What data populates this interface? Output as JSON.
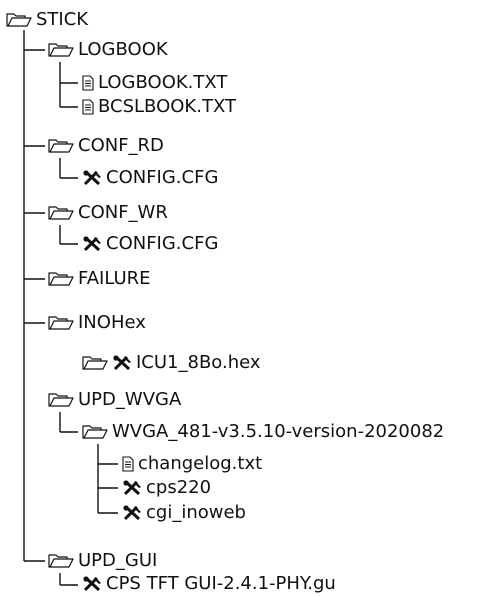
{
  "root": {
    "label": "STICK",
    "icon": "folder-icon"
  },
  "logbook": {
    "label": "LOGBOOK",
    "icon": "folder-icon",
    "files": [
      {
        "label": "LOGBOOK.TXT",
        "icon": "text-file-icon"
      },
      {
        "label": "BCSLBOOK.TXT",
        "icon": "text-file-icon"
      }
    ]
  },
  "conf_rd": {
    "label": "CONF_RD",
    "icon": "folder-icon",
    "file": {
      "label": "CONFIG.CFG",
      "icon": "tools-icon"
    }
  },
  "conf_wr": {
    "label": "CONF_WR",
    "icon": "folder-icon",
    "file": {
      "label": "CONFIG.CFG",
      "icon": "tools-icon"
    }
  },
  "failure": {
    "label": "FAILURE",
    "icon": "folder-icon"
  },
  "inohex": {
    "label": "INOHex",
    "icon": "folder-icon",
    "file": {
      "label": "ICU1_8Bo.hex",
      "icon": "tools-icon"
    }
  },
  "upd_wvga": {
    "label": "UPD_WVGA",
    "icon": "folder-icon",
    "sub": {
      "label": "WVGA_481-v3.5.10-version-2020082",
      "icon": "folder-icon",
      "files": [
        {
          "label": "changelog.txt",
          "icon": "text-file-icon"
        },
        {
          "label": "cps220",
          "icon": "tools-icon"
        },
        {
          "label": "cgi_inoweb",
          "icon": "tools-icon"
        }
      ]
    }
  },
  "upd_gui": {
    "label": "UPD_GUI",
    "icon": "folder-icon",
    "file": {
      "label": "CPS TFT GUI-2.4.1-PHY.gu",
      "icon": "tools-icon"
    }
  }
}
